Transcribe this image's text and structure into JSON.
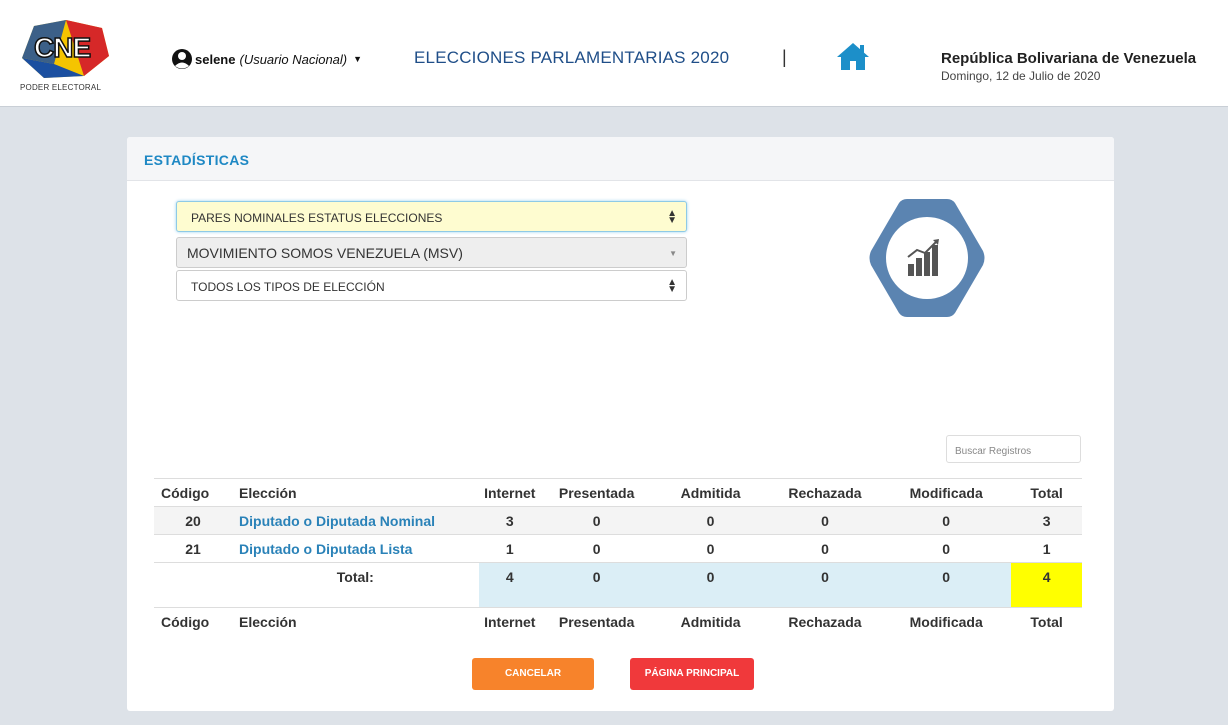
{
  "header": {
    "logo_text": "CNE",
    "logo_subtitle": "PODER ELECTORAL",
    "user_name": "selene",
    "user_role": "(Usuario Nacional)",
    "event_title": "ELECCIONES PARLAMENTARIAS 2020",
    "separator": "|",
    "country": "República Bolivariana de Venezuela",
    "date": "Domingo, 12 de Julio de 2020"
  },
  "page": {
    "title": "ESTADÍSTICAS"
  },
  "filters": {
    "report_type": "PARES NOMINALES ESTATUS ELECCIONES",
    "organization": "MOVIMIENTO SOMOS VENEZUELA (MSV)",
    "election_type": "TODOS LOS TIPOS DE ELECCIÓN"
  },
  "search": {
    "placeholder": "Buscar Registros"
  },
  "table": {
    "headers": [
      "Código",
      "Elección",
      "Internet",
      "Presentada",
      "Admitida",
      "Rechazada",
      "Modificada",
      "Total"
    ],
    "rows": [
      {
        "code": "20",
        "election": "Diputado o Diputada Nominal",
        "internet": "3",
        "presentada": "0",
        "admitida": "0",
        "rechazada": "0",
        "modificada": "0",
        "total": "3"
      },
      {
        "code": "21",
        "election": "Diputado o Diputada Lista",
        "internet": "1",
        "presentada": "0",
        "admitida": "0",
        "rechazada": "0",
        "modificada": "0",
        "total": "1"
      }
    ],
    "totals": {
      "label": "Total:",
      "internet": "4",
      "presentada": "0",
      "admitida": "0",
      "rechazada": "0",
      "modificada": "0",
      "total": "4"
    }
  },
  "buttons": {
    "cancel": "CANCELAR",
    "home": "PÁGINA PRINCIPAL"
  },
  "icons": {
    "user": "user-circle-icon",
    "home": "home-icon",
    "stats": "bar-chart-growth-icon"
  },
  "colors": {
    "accent_blue": "#1e88c4",
    "title_blue": "#1f4e88",
    "home_icon": "#1c8fc9",
    "hex_badge": "#5b84b1",
    "cancel_button": "#f7832b",
    "home_button": "#f0393b",
    "total_highlight": "#ffff00",
    "totals_row": "#dbeef6"
  }
}
